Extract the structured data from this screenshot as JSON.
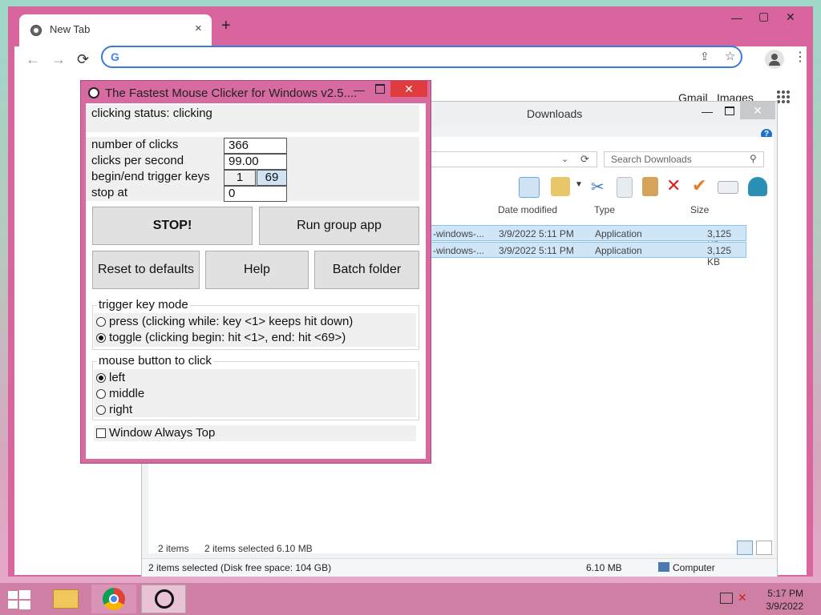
{
  "chrome": {
    "tab_title": "New Tab",
    "tab_close": "×",
    "new_tab": "+",
    "nav": {
      "back": "←",
      "forward": "→",
      "reload": "⟳"
    },
    "omnibox_value": "",
    "google_letter": "G",
    "page_links": {
      "gmail": "Gmail",
      "images": "Images"
    },
    "window_controls": {
      "minimize": "—",
      "maximize": "▢",
      "close": "✕"
    }
  },
  "explorer": {
    "title": "Downloads",
    "search_placeholder": "Search Downloads",
    "columns": {
      "date": "Date modified",
      "type": "Type",
      "size": "Size"
    },
    "rows": [
      {
        "name": "-windows-...",
        "date": "3/9/2022 5:11 PM",
        "type": "Application",
        "size": "3,125 KB"
      },
      {
        "name": "-windows-...",
        "date": "3/9/2022 5:11 PM",
        "type": "Application",
        "size": "3,125 KB"
      }
    ],
    "status": {
      "items": "2 items",
      "selected": "2 items selected",
      "size": "6.10 MB"
    },
    "bottom_status": {
      "left": "2 items selected (Disk free space: 104 GB)",
      "size": "6.10 MB",
      "location": "Computer"
    }
  },
  "clicker": {
    "title": "The Fastest Mouse Clicker for Windows v2.5....",
    "status": "clicking status: clicking",
    "labels": {
      "num_clicks": "number of clicks",
      "cps": "clicks per second",
      "trigger": "begin/end trigger keys",
      "stop_at": "stop at"
    },
    "values": {
      "num_clicks": "366",
      "cps": "99.00",
      "trigger_begin": "1",
      "trigger_end": "69",
      "stop_at": "0"
    },
    "buttons": {
      "stop": "STOP!",
      "run_group": "Run group app",
      "reset": "Reset to defaults",
      "help": "Help",
      "batch": "Batch folder"
    },
    "trigger_mode": {
      "legend": "trigger key mode",
      "press": "press (clicking while: key <1> keeps hit down)",
      "toggle": "toggle (clicking begin: hit <1>, end: hit <69>)",
      "selected": "toggle"
    },
    "mouse_button": {
      "legend": "mouse button to click",
      "left": "left",
      "middle": "middle",
      "right": "right",
      "selected": "left"
    },
    "always_top": "Window Always Top",
    "close": "✕"
  },
  "taskbar": {
    "time": "5:17 PM",
    "date": "3/9/2022"
  },
  "colors": {
    "window_frame": "#d86aa2",
    "close_red": "#e03c3c",
    "selection": "#cfe6f8",
    "taskbar": "#cf7fa3"
  }
}
